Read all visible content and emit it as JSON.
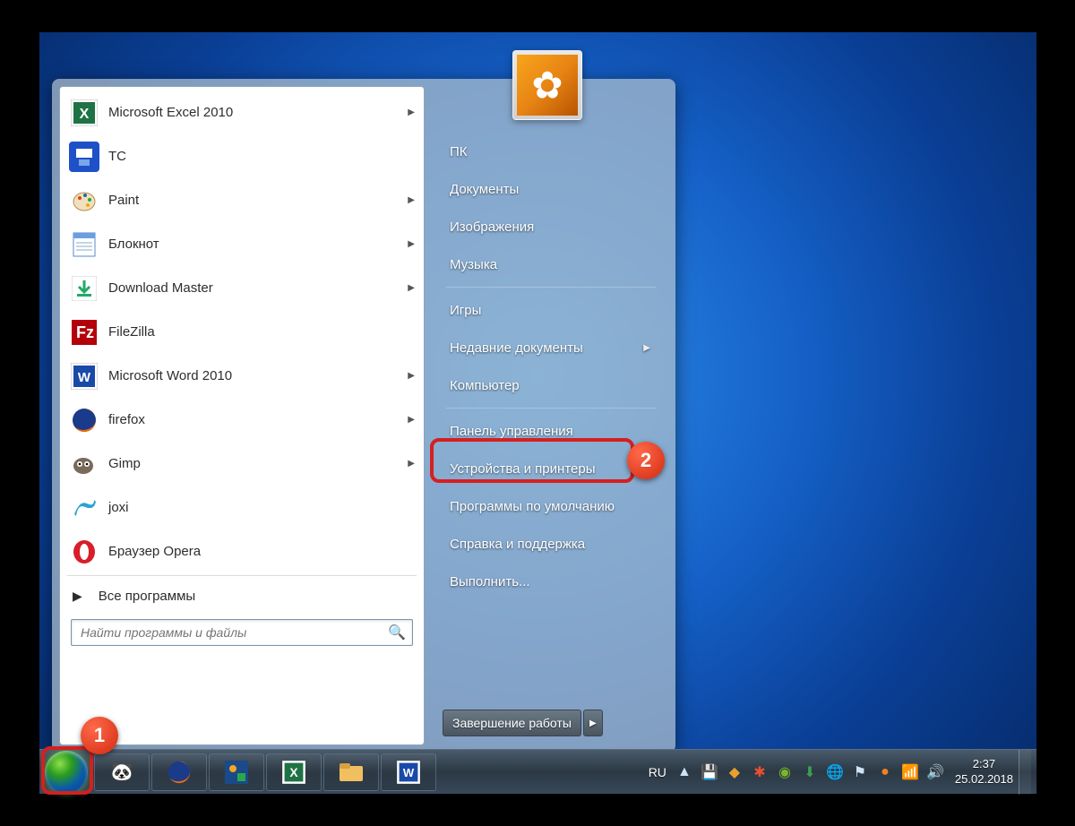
{
  "user": {
    "name": "ПК"
  },
  "apps": [
    {
      "label": "Microsoft Excel 2010",
      "icon": "excel-icon",
      "has_sub": true
    },
    {
      "label": "TC",
      "icon": "save-icon",
      "has_sub": false
    },
    {
      "label": "Paint",
      "icon": "paint-icon",
      "has_sub": true
    },
    {
      "label": "Блокнот",
      "icon": "notepad-icon",
      "has_sub": true
    },
    {
      "label": "Download Master",
      "icon": "download-icon",
      "has_sub": true
    },
    {
      "label": "FileZilla",
      "icon": "filezilla-icon",
      "has_sub": false
    },
    {
      "label": "Microsoft Word 2010",
      "icon": "word-icon",
      "has_sub": true
    },
    {
      "label": "firefox",
      "icon": "firefox-icon",
      "has_sub": true
    },
    {
      "label": "Gimp",
      "icon": "gimp-icon",
      "has_sub": true
    },
    {
      "label": "joxi",
      "icon": "joxi-icon",
      "has_sub": false
    },
    {
      "label": "Браузер Opera",
      "icon": "opera-icon",
      "has_sub": false
    }
  ],
  "all_programs_label": "Все программы",
  "search": {
    "placeholder": "Найти программы и файлы"
  },
  "right": [
    {
      "label": "ПК"
    },
    {
      "label": "Документы"
    },
    {
      "label": "Изображения"
    },
    {
      "label": "Музыка"
    },
    {
      "label": "Игры"
    },
    {
      "label": "Недавние документы",
      "has_sub": true
    },
    {
      "label": "Компьютер"
    },
    {
      "label": "Панель управления",
      "highlighted": true
    },
    {
      "label": "Устройства и принтеры"
    },
    {
      "label": "Программы по умолчанию"
    },
    {
      "label": "Справка и поддержка"
    },
    {
      "label": "Выполнить..."
    }
  ],
  "shutdown_label": "Завершение работы",
  "language": "RU",
  "clock": {
    "time": "2:37",
    "date": "25.02.2018"
  },
  "annotations": {
    "badge1": "1",
    "badge2": "2"
  },
  "colors": {
    "callout": "#d61f1f",
    "desktop_center": "#2e8de8",
    "desktop_edge": "#062b6a"
  }
}
